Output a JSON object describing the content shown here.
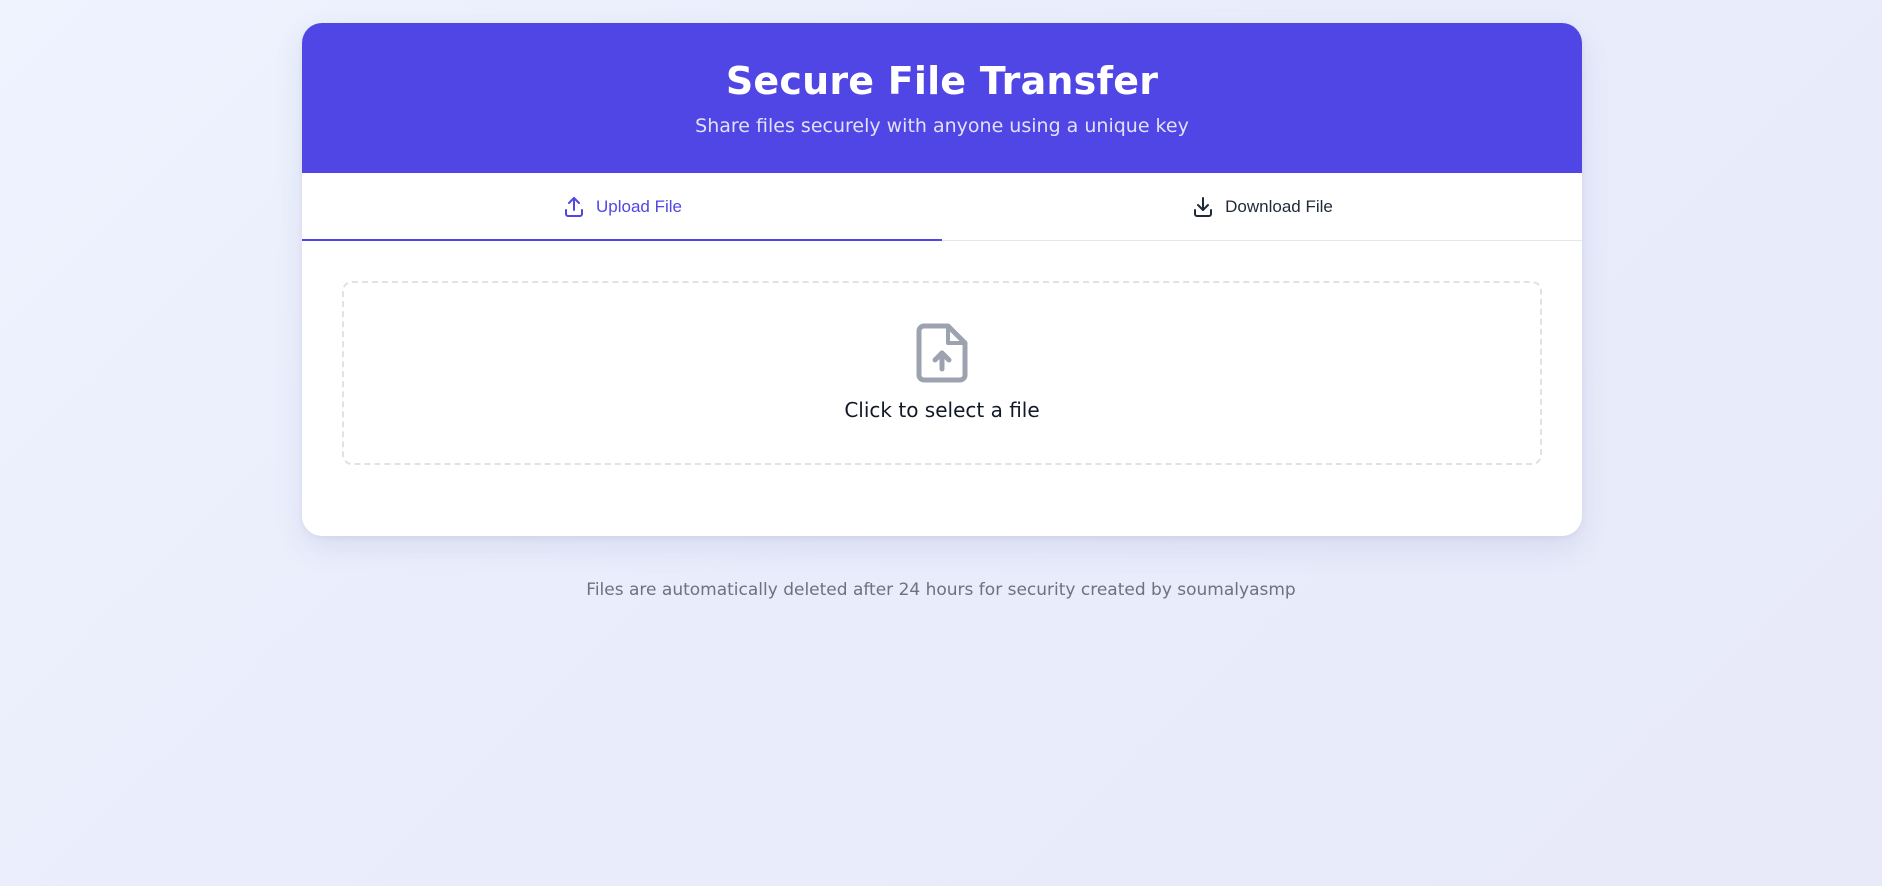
{
  "header": {
    "title": "Secure File Transfer",
    "subtitle": "Share files securely with anyone using a unique key"
  },
  "tabs": [
    {
      "label": "Upload File",
      "icon": "upload-icon",
      "active": true
    },
    {
      "label": "Download File",
      "icon": "download-icon",
      "active": false
    }
  ],
  "dropzone": {
    "icon": "file-upload-icon",
    "label": "Click to select a file"
  },
  "footer": {
    "text": "Files are automatically deleted after 24 hours for security created by soumalyasmp"
  },
  "colors": {
    "accent": "#4f46e5",
    "header_bg": "#5046e5",
    "icon_gray": "#9ca3af"
  }
}
